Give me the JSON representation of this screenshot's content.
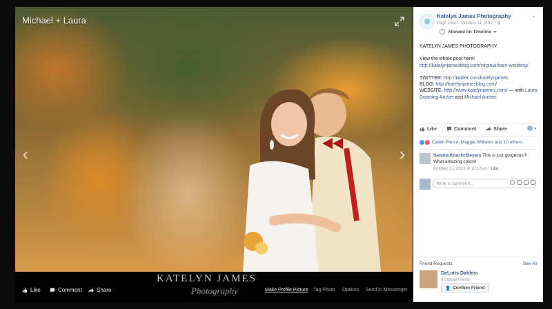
{
  "photo": {
    "title": "Michael + Laura",
    "watermark_line1": "KATELYN JAMES",
    "watermark_line2": "Photography",
    "actions": {
      "like": "Like",
      "comment": "Comment",
      "share": "Share"
    },
    "links": {
      "make_profile_picture": "Make Profile Picture",
      "tag_photo": "Tag Photo",
      "options": "Options",
      "send_in_messenger": "Send in Messenger"
    }
  },
  "post": {
    "page_name": "Katelyn James Photography",
    "meta": "Page Liked · October 31, 2012 ·",
    "timeline_label": "Allowed on Timeline",
    "heading": "KATELYN JAMES PHOTOGRAPHY",
    "view_text": "View the whole post here! ",
    "view_link": "http://katelynjamesblog.com/virginia-barn-wedding/",
    "twitter_label": "TWITTER: ",
    "twitter_link": "http://twitter.com/katelynjames",
    "blog_label": "BLOG: ",
    "blog_link": "http://katelynjamesblog.com/",
    "website_label": "WEBSITE: ",
    "website_link": "http://www.katelynjames.com/",
    "with_text": " — with ",
    "tag1": "Laura Downing Archer",
    "and_text": " and ",
    "tag2": "Michael Archer",
    "end_text": "."
  },
  "actions": {
    "like": "Like",
    "comment": "Comment",
    "share": "Share"
  },
  "reactions_text": "Caitlin Pierce, Maggie Williams and 10 others",
  "comment": {
    "author": "Sandra Knecht Beyers",
    "text": " This is just gorgeous!!! What amazing colors!",
    "time": "October 31, 2012 at 12:17am · ",
    "like": "Like"
  },
  "write_comment_placeholder": "Write a comment...",
  "friend_requests": {
    "title": "Friend Requests",
    "see_all": "See All",
    "name": "DeLoris Dahlem",
    "mutual": "8 mutual friends",
    "confirm": "Confirm Friend"
  },
  "colors": {
    "link": "#385898",
    "viewer_bg": "#000000",
    "page_bg": "#0b0b0c"
  }
}
